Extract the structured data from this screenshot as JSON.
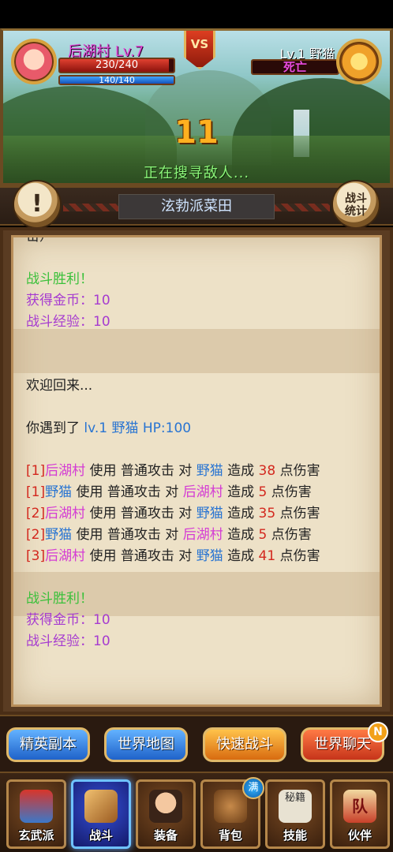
{
  "player": {
    "name": "后湖村 Lv.7",
    "hp_text": "230/240",
    "hp_fraction": 0.958,
    "mp_text": "140/140",
    "mp_fraction": 1.0
  },
  "vs_label": "VS",
  "enemy": {
    "name": "Lv.1 野猫",
    "status": "死亡"
  },
  "countdown": "11",
  "search_status": "正在搜寻敌人...",
  "location": {
    "title": "泫勃派菜田",
    "info_button": "!",
    "stats_button_line1": "战斗",
    "stats_button_line2": "统计"
  },
  "log": {
    "truncated_top": "击）",
    "first_summary": {
      "victory": "战斗胜利！",
      "gold": "获得金币：10",
      "exp": "战斗经验：10"
    },
    "welcome": "欢迎回来...",
    "encounter": {
      "prefix": "你遇到了 ",
      "enemy": "lv.1 野猫 HP:100"
    },
    "rounds": [
      {
        "round": "[1]",
        "actor": "后湖村",
        "mid": " 使用 普通攻击 对 ",
        "target": "野猫",
        "dmg_pre": " 造成 ",
        "dmg": "38",
        "dmg_post": " 点伤害"
      },
      {
        "round": "[1]",
        "actor": "野猫",
        "mid": " 使用 普通攻击 对 ",
        "target": "后湖村",
        "dmg_pre": " 造成 ",
        "dmg": "5",
        "dmg_post": " 点伤害"
      },
      {
        "round": "[2]",
        "actor": "后湖村",
        "mid": " 使用 普通攻击 对 ",
        "target": "野猫",
        "dmg_pre": " 造成 ",
        "dmg": "35",
        "dmg_post": " 点伤害"
      },
      {
        "round": "[2]",
        "actor": "野猫",
        "mid": " 使用 普通攻击 对 ",
        "target": "后湖村",
        "dmg_pre": " 造成 ",
        "dmg": "5",
        "dmg_post": " 点伤害"
      },
      {
        "round": "[3]",
        "actor": "后湖村",
        "mid": " 使用 普通攻击 对 ",
        "target": "野猫",
        "dmg_pre": " 造成 ",
        "dmg": "41",
        "dmg_post": " 点伤害"
      }
    ],
    "second_summary": {
      "victory": "战斗胜利！",
      "gold": "获得金币：10",
      "exp": "战斗经验：10"
    }
  },
  "actions": {
    "elite_dungeon": "精英副本",
    "world_map": "世界地图",
    "quick_battle": "快速战斗",
    "world_chat": "世界聊天",
    "world_chat_badge": "N"
  },
  "nav": {
    "sect": "玄武派",
    "battle": "战斗",
    "equipment": "装备",
    "backpack": "背包",
    "backpack_badge": "满",
    "skills": "技能",
    "partners": "伙伴",
    "skills_scroll_text": "秘籍",
    "partners_flag_text": "队"
  },
  "colors": {
    "victory": "#3ac03a",
    "reward": "#a63bd0",
    "round_index": "#d3281e",
    "actor_player": "#d43bd4",
    "actor_enemy": "#2874d2",
    "damage": "#d3281e"
  }
}
